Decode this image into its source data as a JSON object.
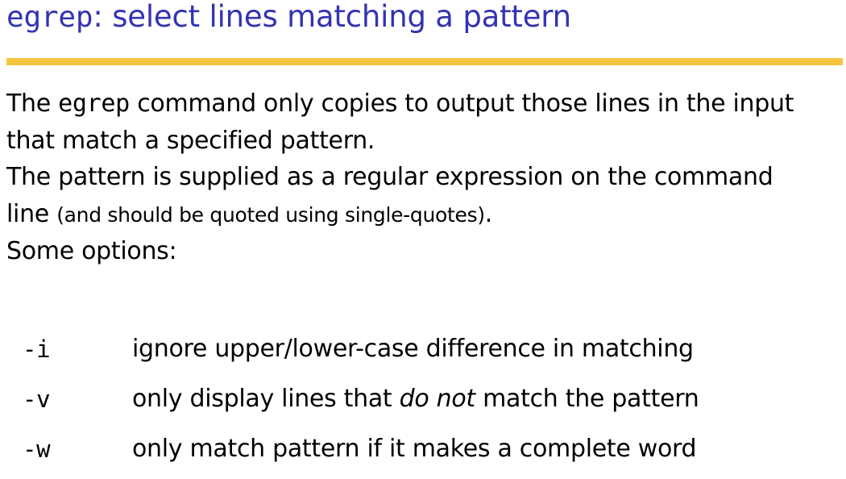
{
  "title": {
    "command": "egrep",
    "rest": ": select lines matching a pattern"
  },
  "body": {
    "p1_pre": "The ",
    "p1_cmd": "egrep",
    "p1_post": " command only copies to output those lines in the input",
    "p1_line2": "that match a specified pattern.",
    "p2_line1": "The pattern is supplied as a regular expression on the command",
    "p2_line2_pre": "line ",
    "p2_line2_small": "(and should be quoted using single-quotes)",
    "p2_line2_post": ".",
    "p3": "Some options:"
  },
  "options": [
    {
      "flag": "-i",
      "desc": "ignore upper/lower-case difference in matching"
    },
    {
      "flag": "-v",
      "desc_pre": "only display lines that ",
      "desc_em": "do not",
      "desc_post": " match the pattern"
    },
    {
      "flag": "-w",
      "desc": "only match pattern if it makes a complete word"
    }
  ],
  "colors": {
    "title": "#3333b3",
    "rule": "#f5c542",
    "text": "#000000"
  }
}
